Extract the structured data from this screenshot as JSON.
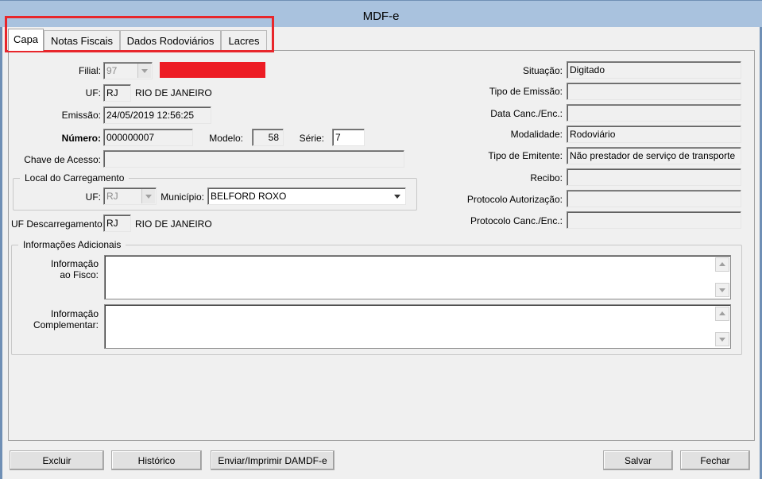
{
  "window": {
    "title": "MDF-e"
  },
  "tabs": [
    {
      "label": "Capa",
      "active": true
    },
    {
      "label": "Notas Fiscais",
      "active": false
    },
    {
      "label": "Dados Rodoviários",
      "active": false
    },
    {
      "label": "Lacres",
      "active": false
    }
  ],
  "left": {
    "filial_label": "Filial:",
    "filial_value": "97",
    "uf_label": "UF:",
    "uf_value": "RJ",
    "uf_name": "RIO DE JANEIRO",
    "emissao_label": "Emissão:",
    "emissao_value": "24/05/2019 12:56:25",
    "numero_label": "Número:",
    "numero_value": "000000007",
    "modelo_label": "Modelo:",
    "modelo_value": "58",
    "serie_label": "Série:",
    "serie_value": "7",
    "chave_label": "Chave de Acesso:",
    "chave_value": ""
  },
  "carregamento": {
    "group_label": "Local do Carregamento",
    "uf_label": "UF:",
    "uf_value": "RJ",
    "municipio_label": "Município:",
    "municipio_value": "BELFORD ROXO"
  },
  "descarregamento": {
    "label": "UF Descarregamento:",
    "uf_value": "RJ",
    "uf_name": "RIO DE JANEIRO"
  },
  "right": {
    "situacao_label": "Situação:",
    "situacao_value": "Digitado",
    "tipo_emissao_label": "Tipo de Emissão:",
    "tipo_emissao_value": "",
    "data_canc_label": "Data Canc./Enc.:",
    "data_canc_value": "",
    "modalidade_label": "Modalidade:",
    "modalidade_value": "Rodoviário",
    "tipo_emitente_label": "Tipo de Emitente:",
    "tipo_emitente_value": "Não prestador de serviço de transporte",
    "recibo_label": "Recibo:",
    "recibo_value": "",
    "protocolo_aut_label": "Protocolo Autorização:",
    "protocolo_aut_value": "",
    "protocolo_canc_label": "Protocolo Canc./Enc.:",
    "protocolo_canc_value": ""
  },
  "info": {
    "group_label": "Informações Adicionais",
    "fisco_label_1": "Informação",
    "fisco_label_2": "ao Fisco:",
    "fisco_value": "",
    "compl_label_1": "Informação",
    "compl_label_2": "Complementar:",
    "compl_value": ""
  },
  "buttons": {
    "excluir": "Excluir",
    "historico": "Histórico",
    "enviar": "Enviar/Imprimir DAMDF-e",
    "salvar": "Salvar",
    "fechar": "Fechar"
  },
  "colors": {
    "titlebar": "#a9c2de",
    "highlight": "#e8262b",
    "redaction": "#ed1c24"
  }
}
